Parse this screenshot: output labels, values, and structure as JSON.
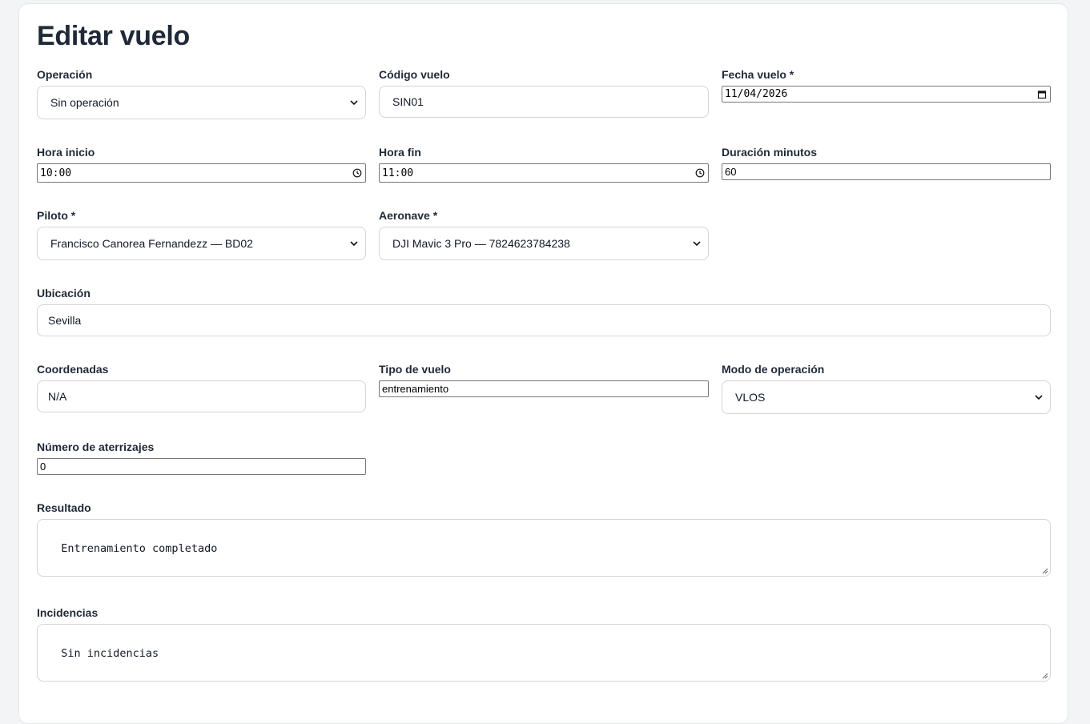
{
  "page": {
    "title": "Editar vuelo"
  },
  "fields": {
    "operacion": {
      "label": "Operación",
      "value": "Sin operación"
    },
    "codigo_vuelo": {
      "label": "Código vuelo",
      "value": "SIN01"
    },
    "fecha_vuelo": {
      "label": "Fecha vuelo *",
      "value": "11/04/2026"
    },
    "hora_inicio": {
      "label": "Hora inicio",
      "value": "10:00"
    },
    "hora_fin": {
      "label": "Hora fin",
      "value": "11:00"
    },
    "duracion_minutos": {
      "label": "Duración minutos",
      "value": "60"
    },
    "piloto": {
      "label": "Piloto *",
      "value": "Francisco Canorea Fernandezz — BD02"
    },
    "aeronave": {
      "label": "Aeronave *",
      "value": "DJI Mavic 3 Pro — 7824623784238"
    },
    "ubicacion": {
      "label": "Ubicación",
      "value": "Sevilla"
    },
    "coordenadas": {
      "label": "Coordenadas",
      "value": "N/A"
    },
    "tipo_vuelo": {
      "label": "Tipo de vuelo",
      "value": "entrenamiento"
    },
    "modo_operacion": {
      "label": "Modo de operación",
      "value": "VLOS"
    },
    "numero_aterrizajes": {
      "label": "Número de aterrizajes",
      "value": "0"
    },
    "resultado": {
      "label": "Resultado",
      "value": "Entrenamiento completado"
    },
    "incidencias": {
      "label": "Incidencias",
      "value": "Sin incidencias"
    }
  },
  "icons": {
    "select": "chevron-down-icon",
    "date": "calendar-icon",
    "time": "clock-icon",
    "textarea": "resize-grip-icon"
  },
  "colors": {
    "text": "#1f2937",
    "border": "#d1d5db",
    "background": "#f3f4f6",
    "card": "#ffffff"
  }
}
